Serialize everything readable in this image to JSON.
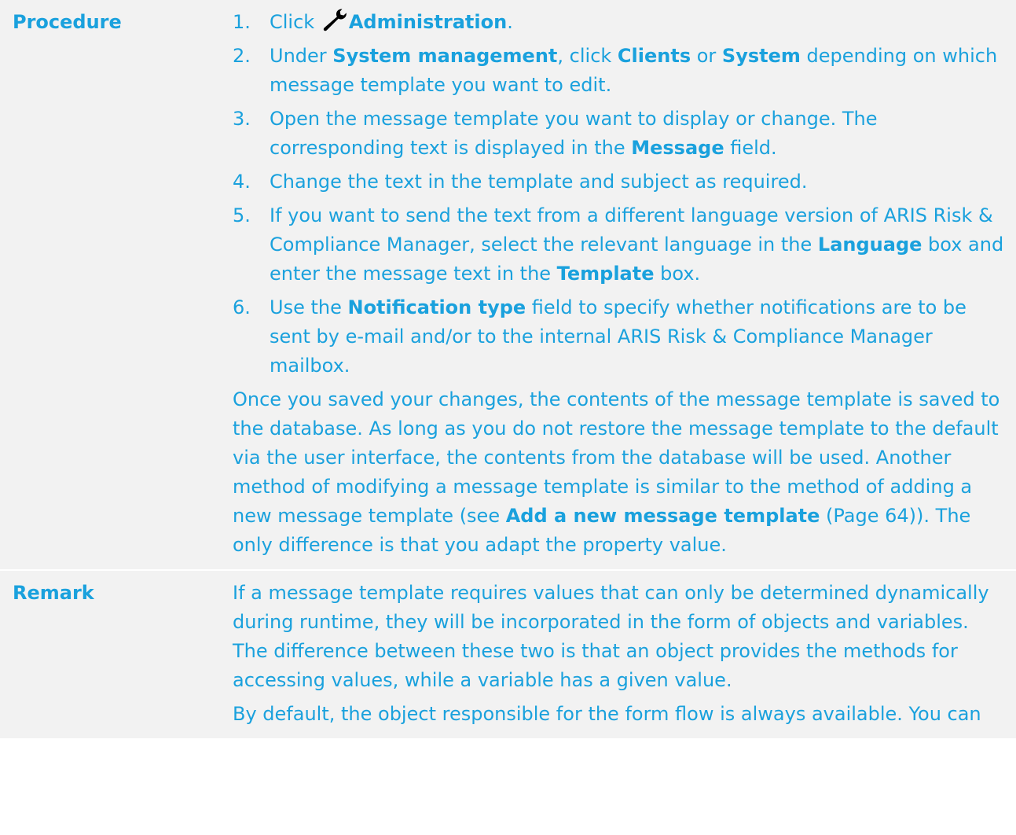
{
  "procedure": {
    "label": "Procedure",
    "steps": [
      {
        "num": "1.",
        "parts": [
          "Click ",
          "Administration",
          "."
        ]
      },
      {
        "num": "2.",
        "parts": [
          "Under ",
          "System management",
          ", click ",
          "Clients",
          " or ",
          "System",
          " depending on which message template you want to edit."
        ]
      },
      {
        "num": "3.",
        "parts": [
          "Open the message template you want to display or change. The corresponding text is displayed in the ",
          "Message",
          " field."
        ]
      },
      {
        "num": "4.",
        "parts": [
          "Change the text in the template and subject as required."
        ]
      },
      {
        "num": "5.",
        "parts": [
          "If you want to send the text from a different language version of ARIS Risk & Compliance Manager, select the relevant language in the ",
          "Language",
          " box and enter the message text in the ",
          "Template",
          " box."
        ]
      },
      {
        "num": "6.",
        "parts": [
          "Use the ",
          "Notification type",
          " field to specify whether notifications are to be sent by e-mail and/or to the internal ARIS Risk & Compliance Manager mailbox."
        ]
      }
    ],
    "note_parts": [
      "Once you saved your changes, the contents of the message template is saved to the database. As long as you do not restore the message template to the default via the user interface, the contents from the database will be used. Another method of modifying a message template is similar to the method of adding a new message template (see ",
      "Add a new message template",
      " (Page 64)). The only difference is that you adapt the property value."
    ]
  },
  "remark": {
    "label": "Remark",
    "paragraphs": [
      "If a message template requires values that can only be determined dynamically during runtime, they will be incorporated in the form of objects and variables. The difference between these two is that an object provides the methods for accessing values, while a variable has a given value.",
      "By default, the object responsible for the form flow is always available. You can"
    ]
  },
  "icons": {
    "administration": "wrench-icon"
  }
}
